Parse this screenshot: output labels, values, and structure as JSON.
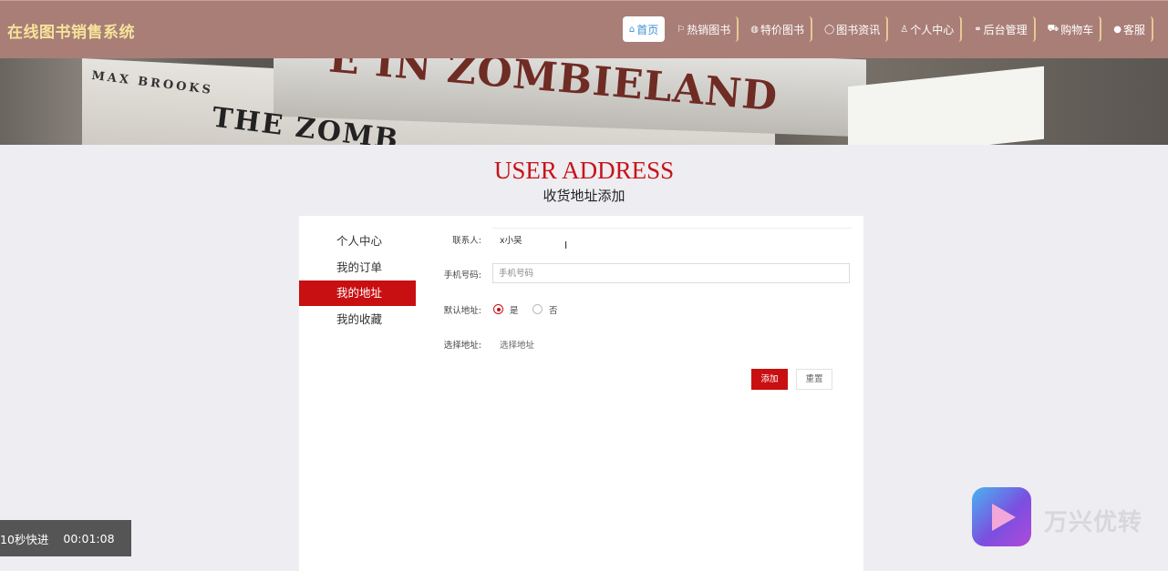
{
  "header": {
    "site_title": "在线图书销售系统",
    "nav": [
      {
        "icon": "home-icon",
        "glyph": "⌂",
        "label": "首页",
        "active": true
      },
      {
        "icon": "flag-icon",
        "glyph": "⚐",
        "label": "热销图书",
        "active": false
      },
      {
        "icon": "tag-icon",
        "glyph": "◍",
        "label": "特价图书",
        "active": false
      },
      {
        "icon": "chat-icon",
        "glyph": "◯",
        "label": "图书资讯",
        "active": false
      },
      {
        "icon": "user-icon",
        "glyph": "♙",
        "label": "个人中心",
        "active": false
      },
      {
        "icon": "link-icon",
        "glyph": "⚭",
        "label": "后台管理",
        "active": false
      },
      {
        "icon": "cart-icon",
        "glyph": "⛟",
        "label": "购物车",
        "active": false
      },
      {
        "icon": "service-icon",
        "glyph": "●",
        "label": "客服",
        "active": false
      }
    ]
  },
  "banner": {
    "book_text_1": "MAX BROOKS",
    "book_text_2": "THE ZOMB",
    "book_text_3": "E IN ZOMBIELAND"
  },
  "section": {
    "title": "USER ADDRESS",
    "subtitle": "收货地址添加"
  },
  "sidebar": {
    "items": [
      {
        "label": "个人中心",
        "active": false
      },
      {
        "label": "我的订单",
        "active": false
      },
      {
        "label": "我的地址",
        "active": true
      },
      {
        "label": "我的收藏",
        "active": false
      }
    ]
  },
  "form": {
    "contact_label": "联系人:",
    "contact_value": "x小吴",
    "phone_label": "手机号码:",
    "phone_placeholder": "手机号码",
    "default_label": "默认地址:",
    "default_yes": "是",
    "default_no": "否",
    "address_label": "选择地址:",
    "address_value": "选择地址",
    "add_button": "添加",
    "reset_button": "重置"
  },
  "overlay": {
    "fast_forward": "10秒快进",
    "timer": "00:01:08",
    "watermark": "万兴优转"
  },
  "colors": {
    "header_bg": "#a97e77",
    "accent": "#c80f12",
    "title_yellow": "#f5e39a"
  }
}
